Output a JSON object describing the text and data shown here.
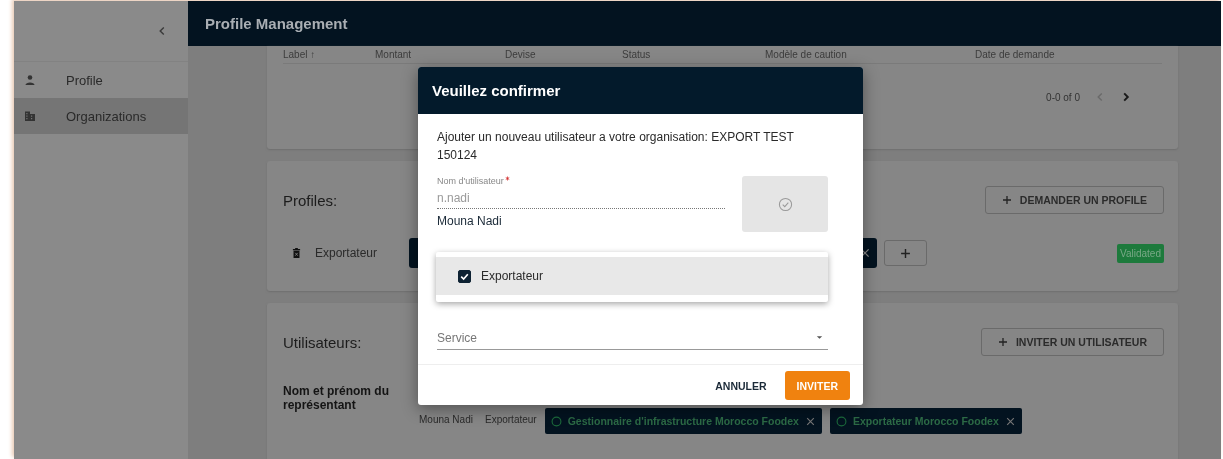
{
  "sidebar": {
    "items": [
      {
        "label": "Profile",
        "selected": false
      },
      {
        "label": "Organizations",
        "selected": true
      }
    ]
  },
  "app_bar": {
    "title": "Profile Management"
  },
  "requests_table": {
    "columns": [
      "Label ↑",
      "Montant",
      "Devise",
      "Status",
      "Modèle de caution",
      "Date de demande"
    ],
    "pagination": "0-0 of 0"
  },
  "profiles": {
    "title": "Profiles:",
    "request_button": "DEMANDER UN PROFILE",
    "rows": [
      {
        "name": "Exportateur",
        "status": "Validated"
      }
    ]
  },
  "users": {
    "title": "Utilisateurs:",
    "invite_button": "INVITER UN UTILISATEUR",
    "column_label": "Nom et prénom du représentant",
    "rows": [
      {
        "name": "Mouna Nadi",
        "profile": "Exportateur",
        "roles": [
          "Gestionnaire d'infrastructure Morocco Foodex",
          "Exportateur Morocco Foodex"
        ]
      }
    ]
  },
  "dialog": {
    "title": "Veuillez confirmer",
    "message": "Ajouter un nouveau utilisateur a votre organisation: EXPORT TEST 150124",
    "username_field": {
      "label": "Nom d'utilisateur",
      "required": true,
      "value": "n.nadi"
    },
    "full_name": "Mouna Nadi",
    "profile_options": [
      {
        "label": "Exportateur",
        "checked": true
      }
    ],
    "service_field": {
      "placeholder": "Service"
    },
    "buttons": [
      {
        "label": "ANNULER",
        "kind": "text"
      },
      {
        "label": "INVITER",
        "kind": "primary"
      }
    ]
  }
}
